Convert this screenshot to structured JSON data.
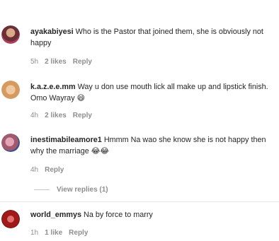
{
  "header_fade_text": "",
  "comments": [
    {
      "username": "ayakabiyesi",
      "text": "Who is the Pastor that joined them, she is obviously not happy",
      "time": "5h",
      "likes": "2 likes",
      "reply": "Reply"
    },
    {
      "username": "k.a.z.e.e.mm",
      "text": "Way u don use mouth lick all make up and lipstick finish. Omo Wayray 😄",
      "time": "4h",
      "likes": "2 likes",
      "reply": "Reply"
    },
    {
      "username": "inestimabileamore1",
      "text": "Hmmm Na wao she know she is not happy then why the marriage 😂😂",
      "time": "4h",
      "reply": "Reply",
      "view_replies": "View replies (1)"
    },
    {
      "username": "world_emmys",
      "text": "Na by force to marry",
      "time": "1h",
      "likes": "1 like",
      "reply": "Reply"
    }
  ],
  "colors": {
    "text": "#262626",
    "secondary": "#8e8e8e"
  }
}
